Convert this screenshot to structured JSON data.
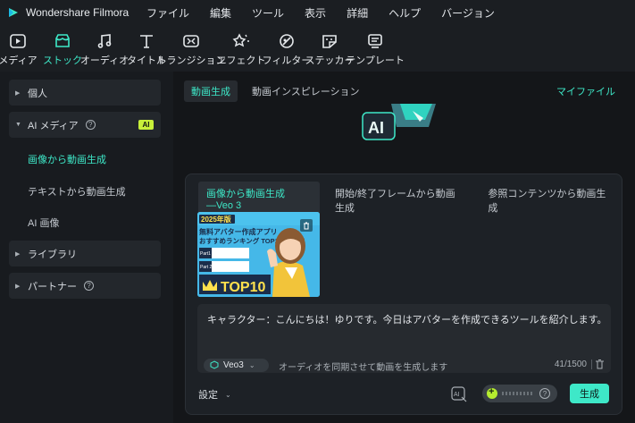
{
  "app": {
    "name": "Wondershare Filmora"
  },
  "menu": [
    "ファイル",
    "編集",
    "ツール",
    "表示",
    "詳細",
    "ヘルプ",
    "バージョン"
  ],
  "toolbar": [
    {
      "label": "メディア",
      "icon": "media-icon"
    },
    {
      "label": "ストック",
      "icon": "stock-icon",
      "active": true
    },
    {
      "label": "オーディオ",
      "icon": "music-note-icon"
    },
    {
      "label": "タイトル",
      "icon": "title-text-icon"
    },
    {
      "label": "トランジション",
      "icon": "transition-icon"
    },
    {
      "label": "エフェクト",
      "icon": "effects-icon"
    },
    {
      "label": "フィルター",
      "icon": "filter-icon"
    },
    {
      "label": "ステッカー",
      "icon": "sticker-icon"
    },
    {
      "label": "テンプレート",
      "icon": "template-icon"
    }
  ],
  "left_panel": {
    "personal": "個人",
    "ai_media": "AI メディア",
    "ai_badge": "AI",
    "sub_items": [
      "画像から動画生成",
      "テキストから動画生成",
      "AI 画像"
    ],
    "library": "ライブラリ",
    "partner": "パートナー"
  },
  "top_tabs": [
    "動画生成",
    "動画インスピレーション"
  ],
  "my_files": "マイファイル",
  "ai_art_label": "AI",
  "card": {
    "tabs": [
      "画像から動画生成―Veo 3",
      "開始/終了フレームから動画生成",
      "参照コンテンツから動画生成"
    ],
    "thumbnail": {
      "year": "2025年版",
      "headline1": "無料アバター作成アプリ",
      "headline2": "おすすめランキング TOP10",
      "part1": "Part1",
      "part2": "Part 2",
      "top10": "TOP10"
    },
    "prompt": "キャラクター：こんにちは！ゆりです。今日はアバターを作成できるツールを紹介します。",
    "model": "Veo3",
    "audio_hint": "オーディオを同期させて動画を生成します",
    "char_count": "41/1500",
    "settings": "設定",
    "generate": "生成"
  },
  "colors": {
    "accent": "#3ee8c8",
    "ai_badge": "#c8f03a",
    "background": "#141619"
  }
}
